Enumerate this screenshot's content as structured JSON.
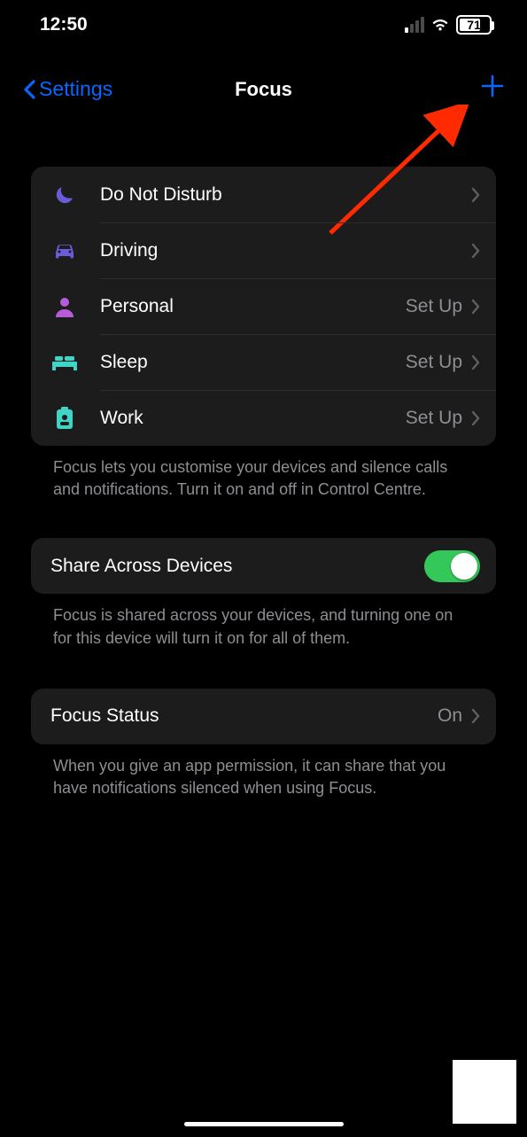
{
  "status": {
    "time": "12:50",
    "battery_pct": "71"
  },
  "nav": {
    "back_label": "Settings",
    "title": "Focus"
  },
  "focus_modes": [
    {
      "label": "Do Not Disturb",
      "trail": "",
      "icon": "moon",
      "color": "#6a5cd8"
    },
    {
      "label": "Driving",
      "trail": "",
      "icon": "car",
      "color": "#6a5cd8"
    },
    {
      "label": "Personal",
      "trail": "Set Up",
      "icon": "person",
      "color": "#b85bd8"
    },
    {
      "label": "Sleep",
      "trail": "Set Up",
      "icon": "bed",
      "color": "#3fd4c5"
    },
    {
      "label": "Work",
      "trail": "Set Up",
      "icon": "badge",
      "color": "#3fd4c5"
    }
  ],
  "focus_footer": "Focus lets you customise your devices and silence calls and notifications. Turn it on and off in Control Centre.",
  "share": {
    "label": "Share Across Devices",
    "on": true,
    "footer": "Focus is shared across your devices, and turning one on for this device will turn it on for all of them."
  },
  "focus_status": {
    "label": "Focus Status",
    "value": "On",
    "footer": "When you give an app permission, it can share that you have notifications silenced when using Focus."
  }
}
